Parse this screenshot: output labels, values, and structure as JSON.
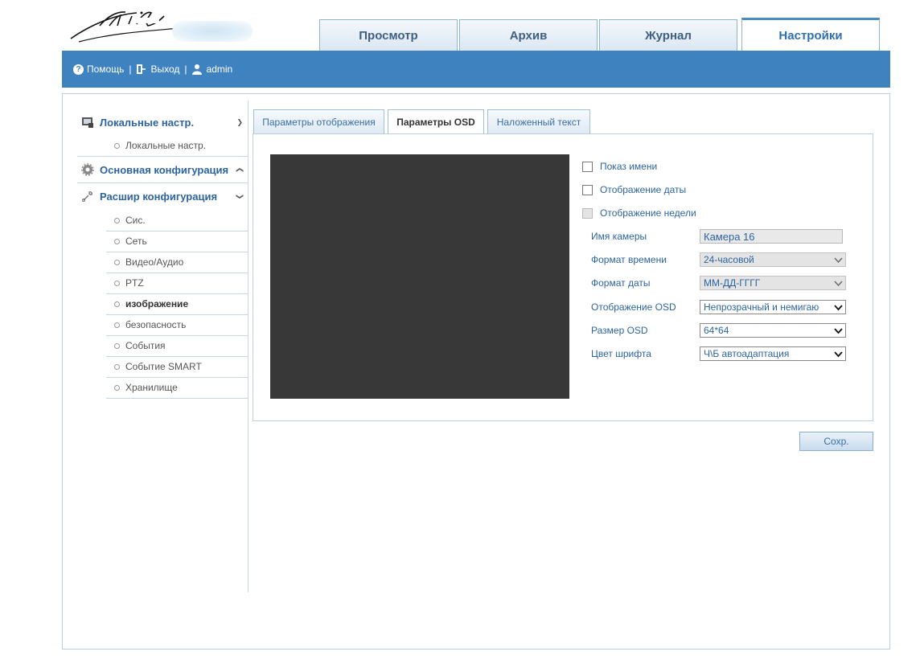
{
  "top_tabs": [
    {
      "label": "Просмотр"
    },
    {
      "label": "Архив"
    },
    {
      "label": "Журнал"
    },
    {
      "label": "Настройки",
      "active": true
    }
  ],
  "userbar": {
    "help": "Помощь",
    "exit": "Выход",
    "separator": "|",
    "user": "admin"
  },
  "sidebar": {
    "local": {
      "label": "Локальные настр.",
      "sub": "Локальные настр."
    },
    "basic": {
      "label": "Основная конфигурация"
    },
    "advanced": {
      "label": "Расшир конфигурация",
      "items": [
        {
          "label": "Сис."
        },
        {
          "label": "Сеть"
        },
        {
          "label": "Видео/Аудио"
        },
        {
          "label": "PTZ"
        },
        {
          "label": "изображение",
          "active": true
        },
        {
          "label": "безопасность"
        },
        {
          "label": "События"
        },
        {
          "label": "Событие SMART"
        },
        {
          "label": "Хранилище"
        }
      ]
    }
  },
  "sub_tabs": [
    {
      "label": "Параметры отображения"
    },
    {
      "label": "Параметры OSD",
      "active": true
    },
    {
      "label": "Наложенный текст"
    }
  ],
  "osd": {
    "show_name": "Показ имени",
    "show_date": "Отображение даты",
    "show_week": "Отображение недели",
    "camera_name_label": "Имя камеры",
    "camera_name_value": "Камера 16",
    "time_format_label": "Формат времени",
    "time_format_value": "24-часовой",
    "date_format_label": "Формат даты",
    "date_format_value": "ММ-ДД-ГГГГ",
    "osd_display_label": "Отображение OSD",
    "osd_display_value": "Непрозрачный и немигаю",
    "osd_size_label": "Размер OSD",
    "osd_size_value": "64*64",
    "font_color_label": "Цвет шрифта",
    "font_color_value": "Ч\\Б автоадаптация"
  },
  "save_label": "Сохр.",
  "colors": {
    "accent": "#3f82c0",
    "link": "#2d64a0",
    "preview": "#383838"
  }
}
